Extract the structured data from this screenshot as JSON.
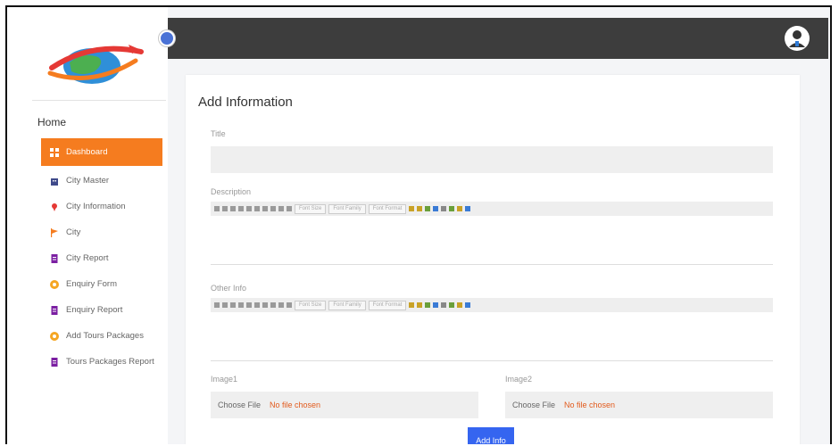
{
  "sidebar": {
    "home_label": "Home",
    "items": [
      {
        "label": "Dashboard",
        "icon": "dashboard-icon",
        "color": "#ffffff",
        "active": true
      },
      {
        "label": "City Master",
        "icon": "building-icon",
        "color": "#3f4a8a"
      },
      {
        "label": "City Information",
        "icon": "map-pin-icon",
        "color": "#e53935"
      },
      {
        "label": "City",
        "icon": "flag-icon",
        "color": "#f57c1f"
      },
      {
        "label": "City Report",
        "icon": "report-icon",
        "color": "#7b1fa2"
      },
      {
        "label": "Enquiry Form",
        "icon": "circle-plus-icon",
        "color": "#f5a623"
      },
      {
        "label": "Enquiry Report",
        "icon": "report-icon",
        "color": "#7b1fa2"
      },
      {
        "label": "Add Tours Packages",
        "icon": "circle-plus-icon",
        "color": "#f5a623"
      },
      {
        "label": "Tours Packages Report",
        "icon": "report-icon",
        "color": "#7b1fa2"
      }
    ]
  },
  "form": {
    "title": "Add Information",
    "title_label": "Title",
    "description_label": "Description",
    "other_info_label": "Other Info",
    "image1_label": "Image1",
    "image2_label": "Image2",
    "choose_file": "Choose File",
    "no_file": "No file chosen",
    "submit": "Add Info"
  },
  "editor_toolbar": {
    "font_size": "Font Size",
    "font_family": "Font Family",
    "font_format": "Font Format"
  },
  "colors": {
    "accent": "#f57c1f",
    "topbar": "#3d3d3d",
    "primary_button": "#3565f0"
  }
}
